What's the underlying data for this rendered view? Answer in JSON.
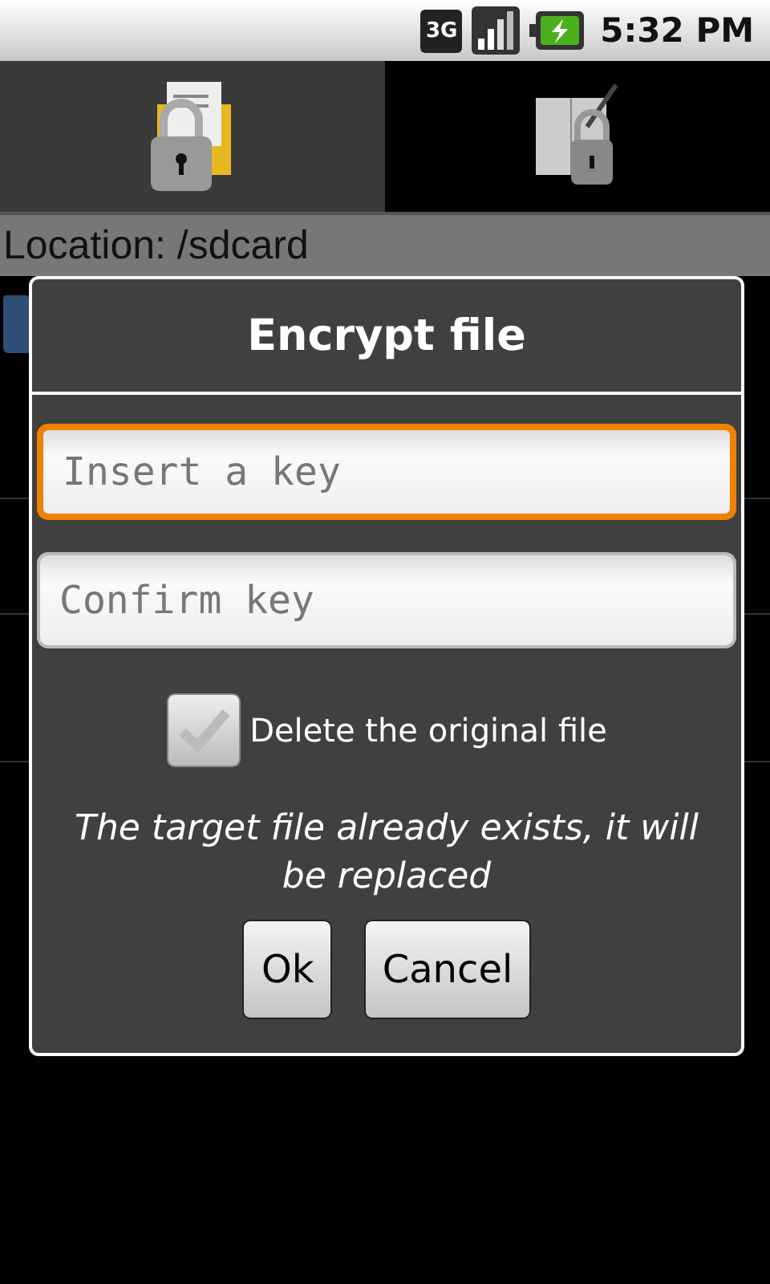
{
  "status_bar": {
    "network": "3G",
    "time": "5:32 PM"
  },
  "tabs": [
    {
      "selected": true
    },
    {
      "selected": false
    }
  ],
  "location": "Location: /sdcard",
  "dialog": {
    "title": "Encrypt file",
    "fields": [
      {
        "placeholder": "Insert a key",
        "focused": true
      },
      {
        "placeholder": "Confirm key",
        "focused": false
      }
    ],
    "checkbox": {
      "label": "Delete the original file",
      "checked": false
    },
    "message": "The target file already exists, it will be replaced",
    "buttons": [
      "Ok",
      "Cancel"
    ]
  }
}
